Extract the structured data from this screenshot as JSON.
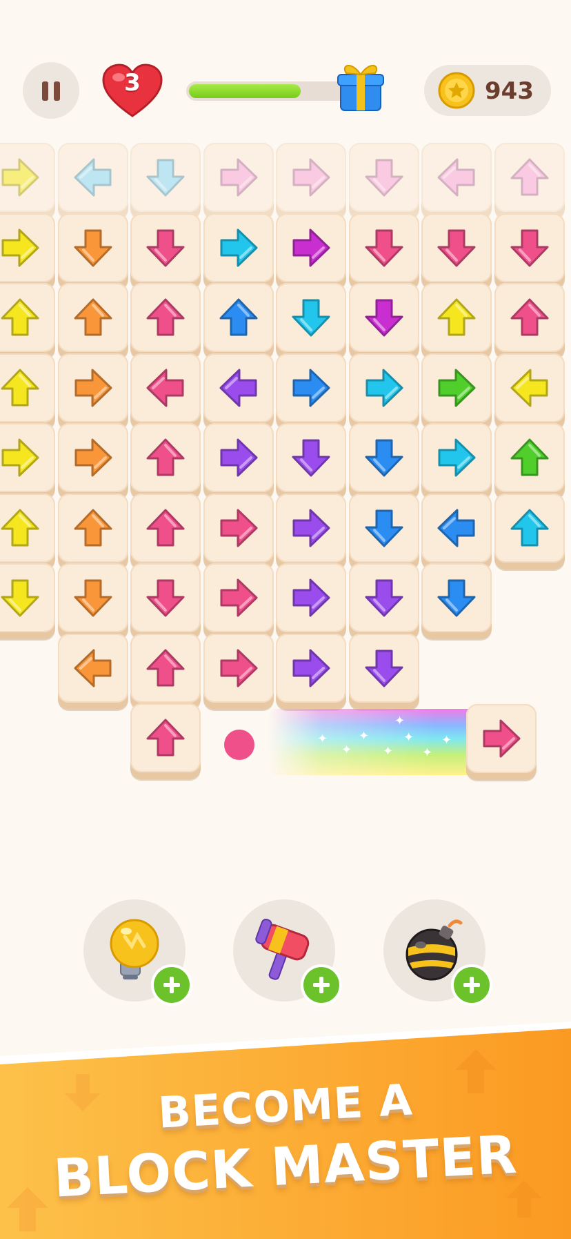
{
  "hud": {
    "pause_icon": "pause-icon",
    "lives": "3",
    "lives_icon": "heart-icon",
    "progress": 0.7,
    "reward_icon": "gift-icon",
    "coins": "943",
    "coin_icon": "coin-icon"
  },
  "colors": {
    "yellow": "#f5e620",
    "orange": "#f9963a",
    "pink": "#f0508a",
    "cyan": "#22c6ec",
    "blue": "#2b8cf2",
    "magenta": "#c92fd0",
    "purple": "#9a4dec",
    "green": "#50cf2c",
    "lightpink": "#f6a6d6",
    "lightblue": "#8ad8f4"
  },
  "board": {
    "rows": [
      {
        "faded": true,
        "tiles": [
          [
            "right",
            "yellow"
          ],
          [
            "left",
            "lightblue"
          ],
          [
            "down",
            "lightblue"
          ],
          [
            "right",
            "lightpink"
          ],
          [
            "right",
            "lightpink"
          ],
          [
            "down",
            "lightpink"
          ],
          [
            "left",
            "lightpink"
          ],
          [
            "up",
            "lightpink"
          ]
        ]
      },
      {
        "faded": false,
        "tiles": [
          [
            "right",
            "yellow"
          ],
          [
            "down",
            "orange"
          ],
          [
            "down",
            "pink"
          ],
          [
            "right",
            "cyan"
          ],
          [
            "right",
            "magenta"
          ],
          [
            "down",
            "pink"
          ],
          [
            "down",
            "pink"
          ],
          [
            "down",
            "pink"
          ]
        ]
      },
      {
        "faded": false,
        "tiles": [
          [
            "up",
            "yellow"
          ],
          [
            "up",
            "orange"
          ],
          [
            "up",
            "pink"
          ],
          [
            "up",
            "blue"
          ],
          [
            "down",
            "cyan"
          ],
          [
            "down",
            "magenta"
          ],
          [
            "up",
            "yellow"
          ],
          [
            "up",
            "pink"
          ]
        ]
      },
      {
        "faded": false,
        "tiles": [
          [
            "up",
            "yellow"
          ],
          [
            "right",
            "orange"
          ],
          [
            "left",
            "pink"
          ],
          [
            "left",
            "purple"
          ],
          [
            "right",
            "blue"
          ],
          [
            "right",
            "cyan"
          ],
          [
            "right",
            "green"
          ],
          [
            "left",
            "yellow"
          ]
        ]
      },
      {
        "faded": false,
        "tiles": [
          [
            "right",
            "yellow"
          ],
          [
            "right",
            "orange"
          ],
          [
            "up",
            "pink"
          ],
          [
            "right",
            "purple"
          ],
          [
            "down",
            "purple"
          ],
          [
            "down",
            "blue"
          ],
          [
            "right",
            "cyan"
          ],
          [
            "up",
            "green"
          ]
        ]
      },
      {
        "faded": false,
        "tiles": [
          [
            "up",
            "yellow"
          ],
          [
            "up",
            "orange"
          ],
          [
            "up",
            "pink"
          ],
          [
            "right",
            "pink"
          ],
          [
            "right",
            "purple"
          ],
          [
            "down",
            "blue"
          ],
          [
            "left",
            "blue"
          ],
          [
            "up",
            "cyan"
          ]
        ]
      },
      {
        "faded": false,
        "tiles": [
          [
            "down",
            "yellow"
          ],
          [
            "down",
            "orange"
          ],
          [
            "down",
            "pink"
          ],
          [
            "right",
            "pink"
          ],
          [
            "right",
            "purple"
          ],
          [
            "down",
            "purple"
          ],
          [
            "down",
            "blue"
          ],
          null
        ]
      },
      {
        "faded": false,
        "tiles": [
          null,
          [
            "left",
            "orange"
          ],
          [
            "up",
            "pink"
          ],
          [
            "right",
            "pink"
          ],
          [
            "right",
            "purple"
          ],
          [
            "down",
            "purple"
          ],
          null,
          null
        ]
      },
      {
        "faded": false,
        "tiles": [
          null,
          null,
          [
            "up",
            "pink"
          ],
          null,
          null,
          null,
          null,
          null
        ]
      }
    ],
    "moving_tile": [
      "right",
      "pink"
    ],
    "ball_color": "pink"
  },
  "boosters": [
    {
      "name": "hint",
      "icon": "lightbulb-icon"
    },
    {
      "name": "hammer",
      "icon": "hammer-icon"
    },
    {
      "name": "bomb",
      "icon": "bomb-icon"
    }
  ],
  "banner": {
    "line1": "BECOME A",
    "line2": "BLOCK MASTER"
  }
}
